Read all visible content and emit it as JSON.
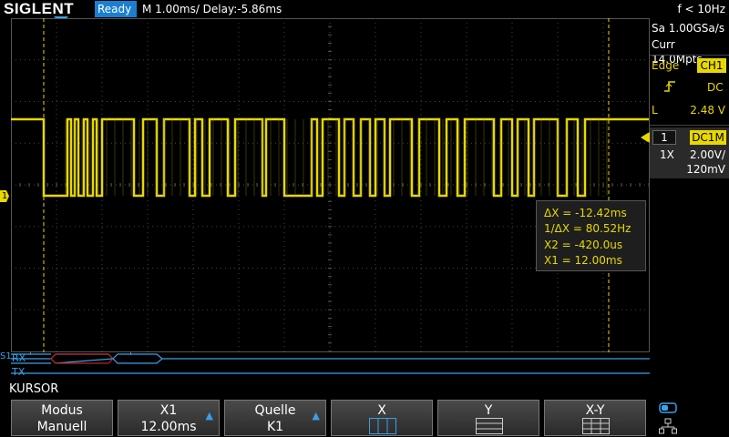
{
  "header": {
    "brand": "SIGLENT",
    "status": "Ready",
    "timebase": "M 1.00ms/ Delay:-5.86ms",
    "frequency": "f < 10Hz"
  },
  "acquisition": {
    "sample_rate": "Sa 1.00GSa/s",
    "memory_depth": "Curr 14.0Mpts"
  },
  "trigger": {
    "type": "Edge",
    "source": "CH1",
    "coupling": "DC",
    "level_label": "L",
    "level": "2.48 V"
  },
  "channel": {
    "number": "1",
    "coupling_impedance": "DC1M",
    "probe": "1X",
    "scale": "2.00V/",
    "offset": "120mV",
    "marker_label": "1"
  },
  "cursor_readout": {
    "delta_x": "ΔX = -12.42ms",
    "inverse_delta_x": "1/ΔX = 80.52Hz",
    "x2": "X2 = -420.0us",
    "x1": "X1 = 12.00ms"
  },
  "serial_bus": {
    "label": "S1",
    "rx_label": "RX",
    "tx_label": "TX",
    "rx_tick_1": "'",
    "rx_tick_2": "'"
  },
  "menu": {
    "title": "KURSOR",
    "buttons": [
      {
        "line1": "Modus",
        "line2": "Manuell"
      },
      {
        "line1": "X1",
        "line2": "12.00ms"
      },
      {
        "line1": "Quelle",
        "line2": "K1"
      },
      {
        "line1": "X",
        "line2": ""
      },
      {
        "line1": "Y",
        "line2": ""
      },
      {
        "line1": "X-Y",
        "line2": ""
      }
    ]
  },
  "colors": {
    "channel1": "#e8d800",
    "accent": "#1a7fd0",
    "bus": "#3aa0e8",
    "bus_error": "#c02020"
  },
  "icons": {
    "arrow": "up-arrow-icon",
    "network": "network-icon",
    "cursor_mode": "cursor-mode-icon"
  }
}
